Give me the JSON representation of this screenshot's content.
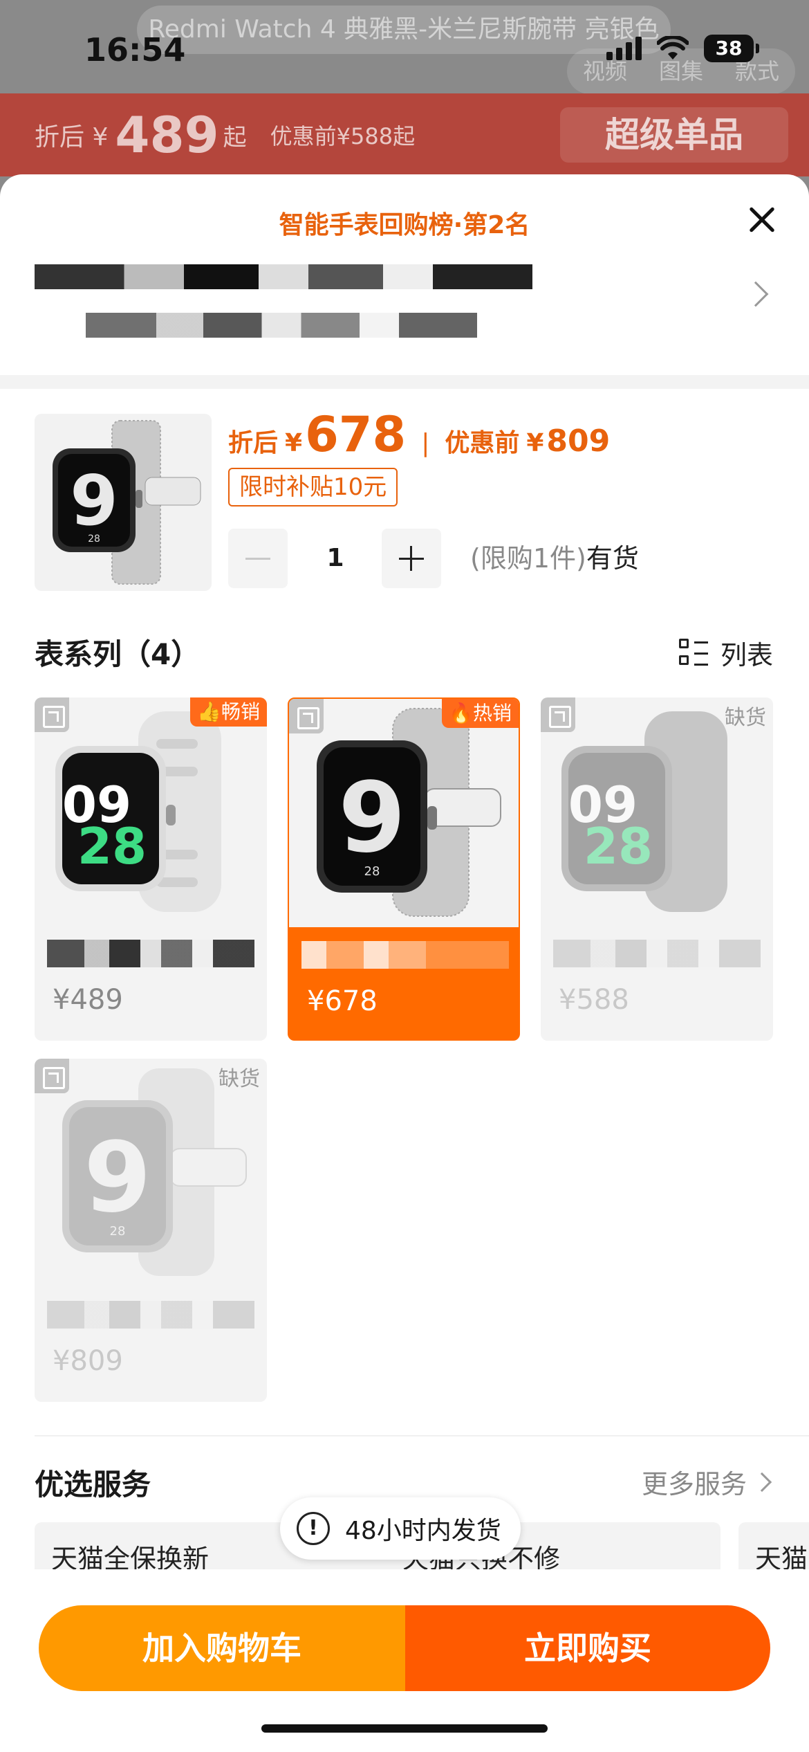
{
  "background": {
    "product_title": "Redmi Watch 4 典雅黑-米兰尼斯腕带 亮银色",
    "tabs": [
      "视频",
      "图集",
      "款式"
    ],
    "promo": {
      "label": "折后 ¥",
      "price": "489",
      "suffix": "起",
      "original": "优惠前¥588起",
      "tag": "超级单品"
    }
  },
  "status_bar": {
    "time": "16:54",
    "battery": "38"
  },
  "sheet": {
    "rank_title": "智能手表回购榜·第2名",
    "summary": {
      "after_label": "折后",
      "currency": "¥",
      "price": "678",
      "before_label": "优惠前",
      "before_price": "809",
      "subsidy": "限时补贴10元",
      "quantity": "1",
      "limit": "(限购1件)",
      "stock": "有货"
    },
    "series": {
      "title": "表系列（4）",
      "view_toggle": "列表",
      "items": [
        {
          "price": "¥489",
          "badge": "畅销",
          "state": "normal",
          "band_color": "#e6e6e6"
        },
        {
          "price": "¥678",
          "badge": "热销",
          "state": "selected",
          "band_color": "#c9c9c9"
        },
        {
          "price": "¥588",
          "badge": "缺货",
          "state": "disabled",
          "band_color": "#9a9a9a"
        },
        {
          "price": "¥809",
          "badge": "缺货",
          "state": "disabled",
          "band_color": "#d4d4d4"
        }
      ]
    },
    "services": {
      "title": "优选服务",
      "more": "更多服务",
      "cards": [
        "天猫全保换新",
        "天猫只换不修",
        "天猫"
      ]
    },
    "toast": "48小时内发货",
    "buttons": {
      "cart": "加入购物车",
      "buy": "立即购买"
    }
  }
}
